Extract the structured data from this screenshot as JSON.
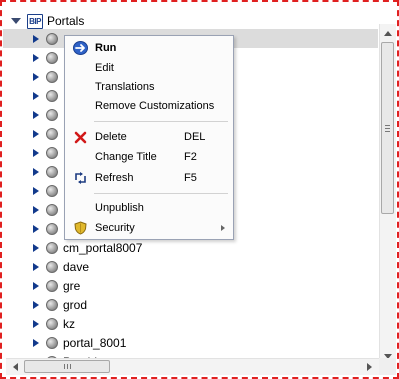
{
  "tree": {
    "root_label": "Portals",
    "nodes": [
      {
        "label": ""
      },
      {
        "label": ""
      },
      {
        "label": ""
      },
      {
        "label": ""
      },
      {
        "label": ""
      },
      {
        "label": ""
      },
      {
        "label": ""
      },
      {
        "label": ""
      },
      {
        "label": ""
      },
      {
        "label": ""
      },
      {
        "label": ""
      },
      {
        "label": "cm_portal8007"
      },
      {
        "label": "dave"
      },
      {
        "label": "gre"
      },
      {
        "label": "grod"
      },
      {
        "label": "kz"
      },
      {
        "label": "portal_8001"
      },
      {
        "label": "Provider"
      }
    ]
  },
  "context_menu": {
    "run": "Run",
    "edit": "Edit",
    "translations": "Translations",
    "remove_customizations": "Remove Customizations",
    "delete": "Delete",
    "delete_key": "DEL",
    "change_title": "Change Title",
    "change_title_key": "F2",
    "refresh": "Refresh",
    "refresh_key": "F5",
    "unpublish": "Unpublish",
    "security": "Security"
  },
  "colors": {
    "focus_border": "#e02020",
    "selected_row": "#dcdcdc",
    "expander_arrow": "#123a8c",
    "delete_icon": "#d11818"
  }
}
